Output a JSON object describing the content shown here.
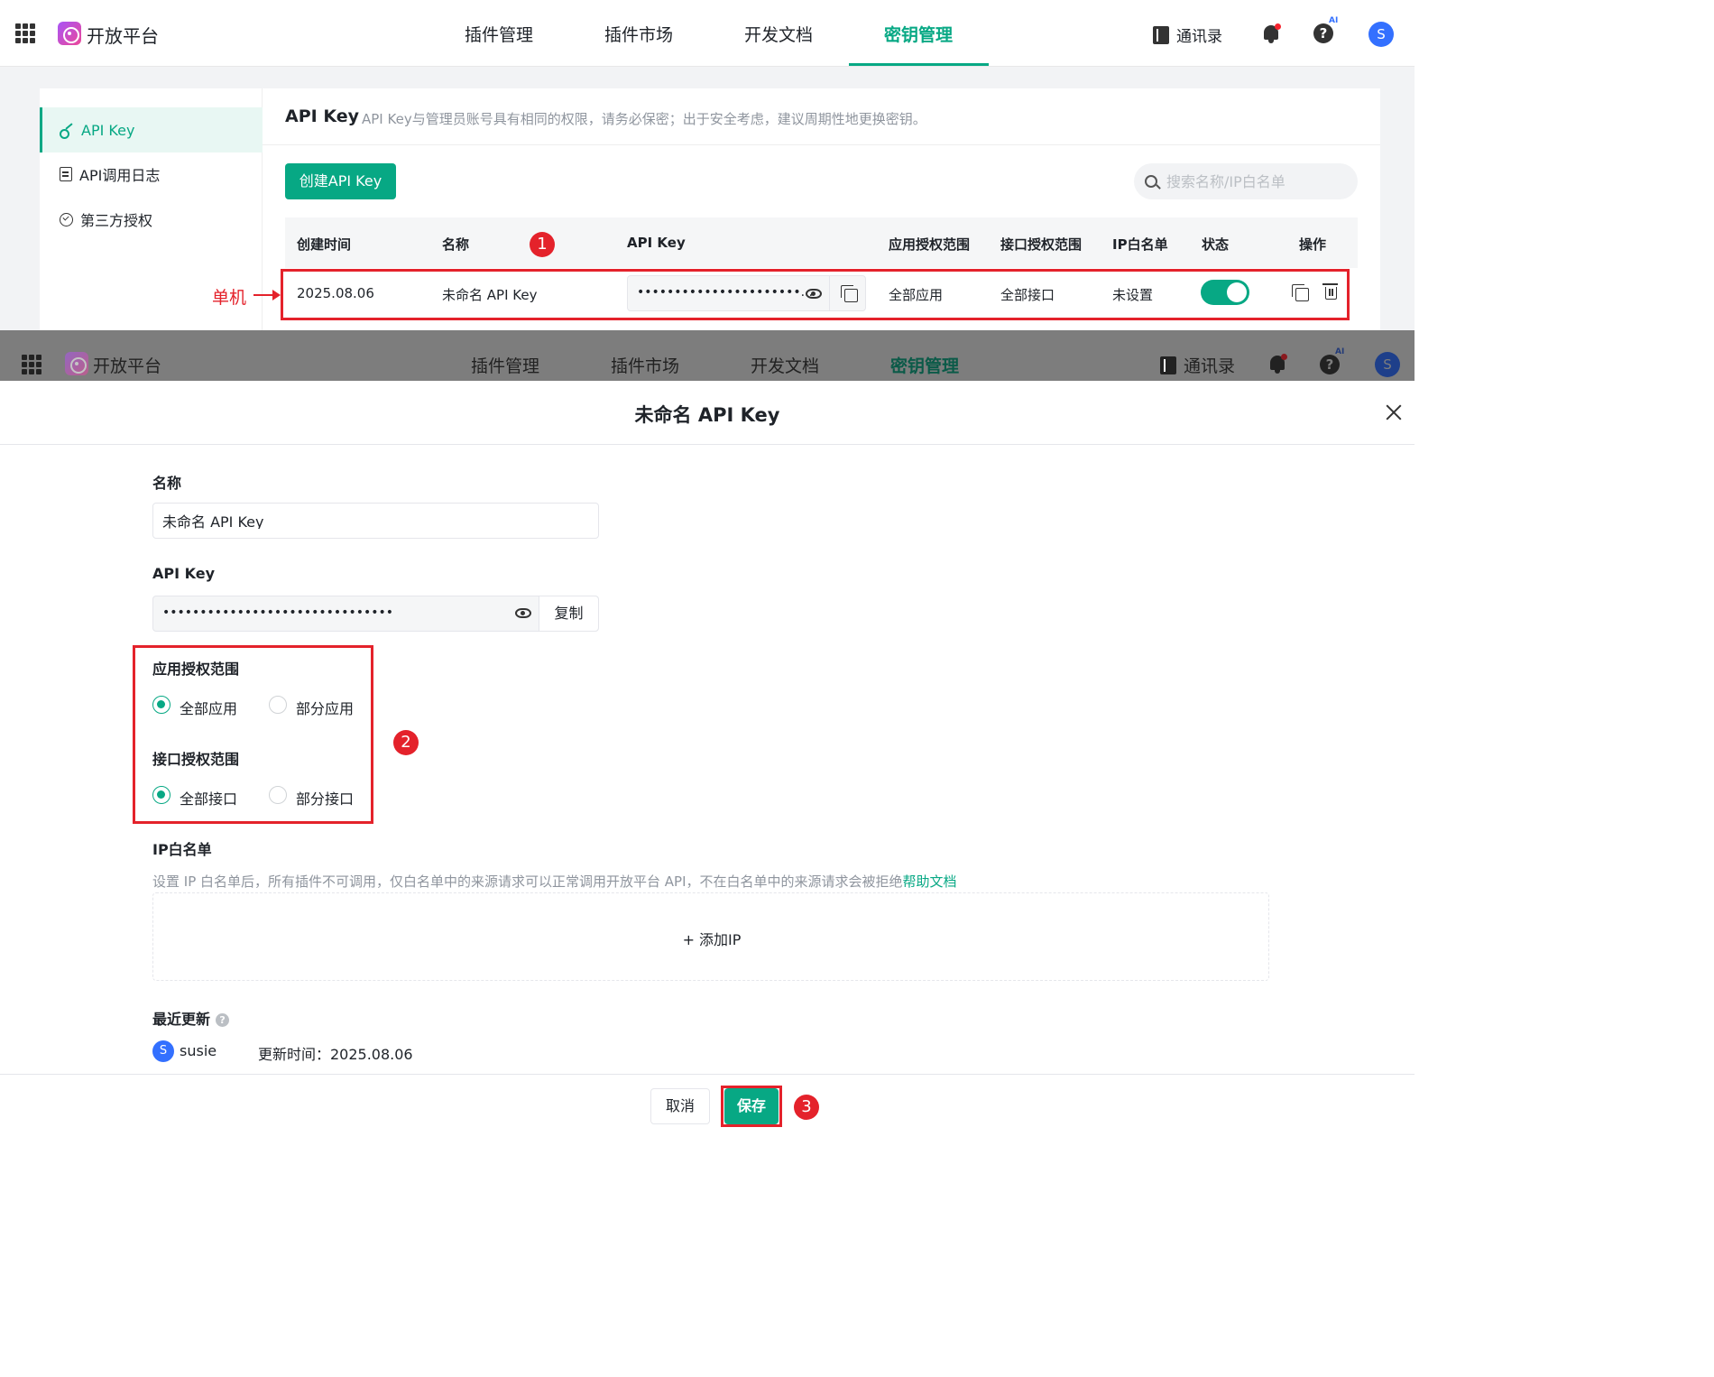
{
  "brand": "开放平台",
  "nav": {
    "items": [
      "插件管理",
      "插件市场",
      "开发文档",
      "密钥管理"
    ],
    "active": "密钥管理",
    "contacts": "通讯录",
    "ai_badge": "AI",
    "user_initial": "S"
  },
  "sidebar": {
    "items": [
      {
        "label": "API Key",
        "icon": "key-icon",
        "active": true
      },
      {
        "label": "API调用日志",
        "icon": "log-icon",
        "active": false
      },
      {
        "label": "第三方授权",
        "icon": "auth-icon",
        "active": false
      }
    ]
  },
  "header": {
    "title": "API Key",
    "description": "API Key与管理员账号具有相同的权限，请务必保密；出于安全考虑，建议周期性地更换密钥。"
  },
  "toolbar": {
    "create_label": "创建API Key",
    "search_placeholder": "搜索名称/IP白名单"
  },
  "table": {
    "columns": [
      "创建时间",
      "名称",
      "API Key",
      "应用授权范围",
      "接口授权范围",
      "IP白名单",
      "状态",
      "操作"
    ],
    "row": {
      "created": "2025.08.06",
      "name": "未命名 API Key",
      "key_masked": "••••••••••••••••••••••...",
      "app_scope": "全部应用",
      "api_scope": "全部接口",
      "ip_whitelist": "未设置",
      "enabled": true
    }
  },
  "annotations": {
    "single_click": "单机",
    "num1": "1",
    "num2": "2",
    "num3": "3",
    "color": "#e4222b"
  },
  "modal": {
    "title": "未命名 API Key",
    "name_label": "名称",
    "name_value": "未命名 API Key",
    "key_label": "API Key",
    "key_masked": "•••••••••••••••••••••••••••••••",
    "copy_label": "复制",
    "app_scope_label": "应用授权范围",
    "app_scope_options": [
      "全部应用",
      "部分应用"
    ],
    "app_scope_selected": "全部应用",
    "api_scope_label": "接口授权范围",
    "api_scope_options": [
      "全部接口",
      "部分接口"
    ],
    "api_scope_selected": "全部接口",
    "ip_label": "IP白名单",
    "ip_desc": "设置 IP 白名单后，所有插件不可调用，仅白名单中的来源请求可以正常调用开放平台 API，不在白名单中的来源请求会被拒绝",
    "help_link": "帮助文档",
    "add_ip": "+ 添加IP",
    "recent_label": "最近更新",
    "user_initial": "S",
    "user_name": "susie",
    "update_time": "更新时间：2025.08.06",
    "cancel_label": "取消",
    "save_label": "保存"
  },
  "colors": {
    "accent": "#07a884",
    "avatar": "#3370ff"
  }
}
